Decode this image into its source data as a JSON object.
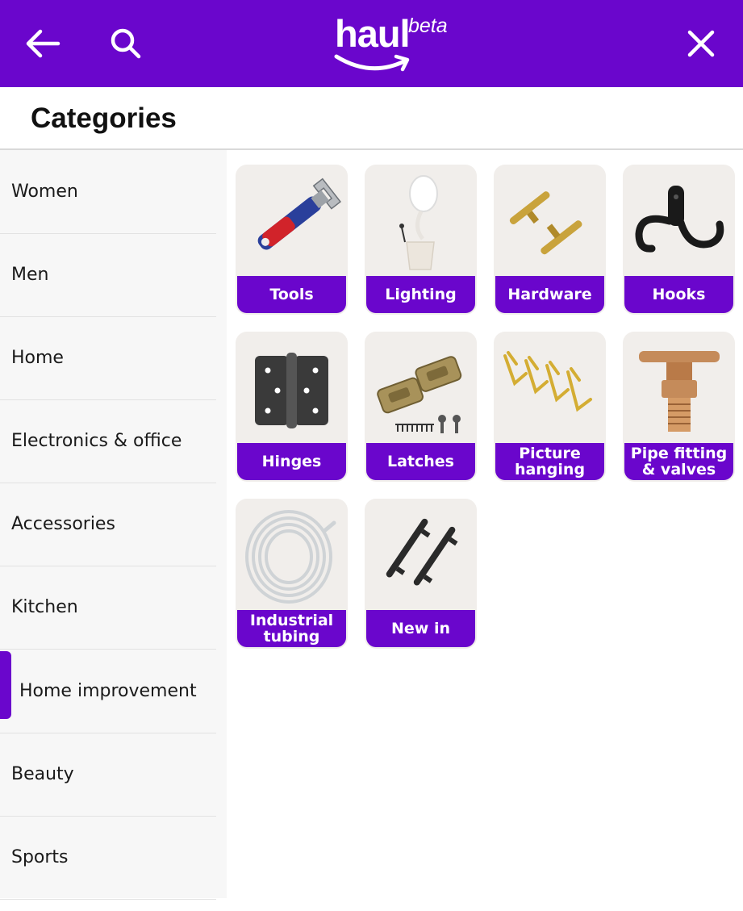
{
  "header": {
    "logo_word": "haul",
    "logo_superscript": "beta",
    "back_icon": "arrow-left-icon",
    "search_icon": "search-icon",
    "close_icon": "close-icon",
    "color": "#6a06cc"
  },
  "page": {
    "title": "Categories"
  },
  "sidebar": {
    "items": [
      {
        "label": "Women",
        "active": false
      },
      {
        "label": "Men",
        "active": false
      },
      {
        "label": "Home",
        "active": false
      },
      {
        "label": "Electronics & office",
        "active": false
      },
      {
        "label": "Accessories",
        "active": false
      },
      {
        "label": "Kitchen",
        "active": false
      },
      {
        "label": "Home improvement",
        "active": true
      },
      {
        "label": "Beauty",
        "active": false
      },
      {
        "label": "Sports",
        "active": false
      }
    ]
  },
  "grid": {
    "tiles": [
      {
        "label": "Tools",
        "icon": "wrench-icon"
      },
      {
        "label": "Lighting",
        "icon": "desk-lamp-icon"
      },
      {
        "label": "Hardware",
        "icon": "cabinet-pull-icon"
      },
      {
        "label": "Hooks",
        "icon": "double-hook-icon"
      },
      {
        "label": "Hinges",
        "icon": "hinge-icon"
      },
      {
        "label": "Latches",
        "icon": "latch-icon"
      },
      {
        "label": "Picture\nhanging",
        "icon": "picture-hook-icon"
      },
      {
        "label": "Pipe fitting\n& valves",
        "icon": "pipe-valve-icon"
      },
      {
        "label": "Industrial\ntubing",
        "icon": "tubing-coil-icon"
      },
      {
        "label": "New in",
        "icon": "bar-handle-icon"
      }
    ]
  }
}
